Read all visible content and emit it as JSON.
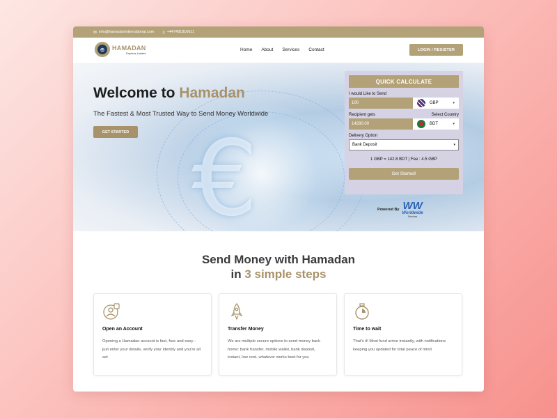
{
  "topbar": {
    "email": "info@hamadaninternational.com",
    "phone": "+447481816611",
    "email_icon": "mail-icon",
    "phone_icon": "phone-icon"
  },
  "logo": {
    "name": "HAMADAN",
    "subtitle": "Express Limited",
    "icon": "globe-icon"
  },
  "nav": {
    "items": [
      "Home",
      "About",
      "Services",
      "Contact"
    ],
    "login_label": "LOGIN / REGISTER"
  },
  "hero": {
    "title_prefix": "Welcome to ",
    "title_accent": "Hamadan",
    "subtitle": "The Fastest & Most Trusted Way to Send Money Worldwide",
    "cta_label": "GET STARTED"
  },
  "calculator": {
    "heading": "QUICK CALCULATE",
    "send_label": "I would Like to Send",
    "send_value": "100",
    "send_currency": "GBP",
    "recipient_label": "Recipient gets",
    "country_label": "Select Country",
    "recipient_value": "14280.00",
    "recipient_currency": "BDT",
    "delivery_label": "Delivery Option",
    "delivery_value": "Bank Deposit",
    "rate_text": "1 GBP = 142.8 BDT | Fee : 4.5 GBP",
    "button_label": "Get Started!"
  },
  "powered": {
    "label": "Powered By",
    "logo_mark": "WW",
    "logo_name": "Worldwide",
    "logo_sub": "Services"
  },
  "steps": {
    "title_line1": "Send Money with Hamadan",
    "title_line2_prefix": "in ",
    "title_line2_accent": "3 simple steps",
    "cards": [
      {
        "icon": "account-icon",
        "title": "Open an Account",
        "text": "Opening a Hamadan account is fast, free and easy - just enter your details, verify your identity and you're all set"
      },
      {
        "icon": "rocket-icon",
        "title": "Transfer Money",
        "text": "We are multiple secure options to send money back home: bank transfer, mobile wallet, bank deposit, instant, low cost, whatever works best for you"
      },
      {
        "icon": "stopwatch-icon",
        "title": "Time to wait",
        "text": "That's it! Most fund arrive instantly, with notifications keeping you updated for total peace of mind"
      }
    ]
  },
  "colors": {
    "accent": "#b3a178",
    "accent_text": "#a8926a",
    "dark": "#1d1d1d",
    "background_pink": "#fbb8b4"
  }
}
